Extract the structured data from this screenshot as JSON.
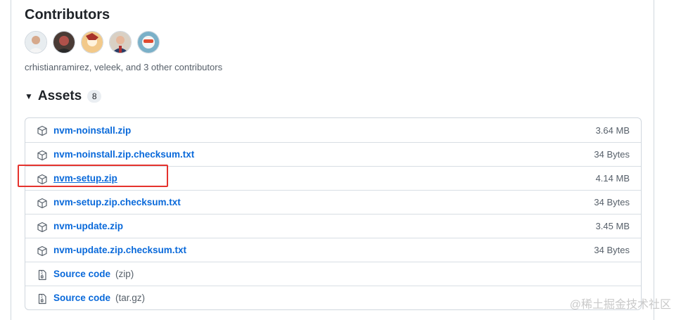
{
  "contributors": {
    "title": "Contributors",
    "summary": "crhistianramirez, veleek, and 3 other contributors",
    "avatars": [
      {
        "icon": "avatar-person-1",
        "bg": "#e8edf0",
        "fg": "#c9a58a"
      },
      {
        "icon": "avatar-person-2",
        "bg": "#4a3b35",
        "fg": "#b0514a"
      },
      {
        "icon": "avatar-person-3",
        "bg": "#f2c98a",
        "fg": "#a8322a"
      },
      {
        "icon": "avatar-person-4",
        "bg": "#d9d0c4",
        "fg": "#2b3d66"
      },
      {
        "icon": "avatar-person-5",
        "bg": "#7ab0c8",
        "fg": "#e04a2f"
      }
    ]
  },
  "assets": {
    "title": "Assets",
    "count": "8",
    "items": [
      {
        "name": "nvm-noinstall.zip",
        "ext": "",
        "size": "3.64 MB",
        "icon": "package-icon"
      },
      {
        "name": "nvm-noinstall.zip.checksum.txt",
        "ext": "",
        "size": "34 Bytes",
        "icon": "package-icon"
      },
      {
        "name": "nvm-setup.zip",
        "ext": "",
        "size": "4.14 MB",
        "icon": "package-icon"
      },
      {
        "name": "nvm-setup.zip.checksum.txt",
        "ext": "",
        "size": "34 Bytes",
        "icon": "package-icon"
      },
      {
        "name": "nvm-update.zip",
        "ext": "",
        "size": "3.45 MB",
        "icon": "package-icon"
      },
      {
        "name": "nvm-update.zip.checksum.txt",
        "ext": "",
        "size": "34 Bytes",
        "icon": "package-icon"
      },
      {
        "name": "Source code",
        "ext": "(zip)",
        "size": "",
        "icon": "file-zip-icon"
      },
      {
        "name": "Source code",
        "ext": "(tar.gz)",
        "size": "",
        "icon": "file-zip-icon"
      }
    ]
  },
  "watermark": "@稀土掘金技术社区",
  "colors": {
    "link": "#0969da",
    "highlight": "#e5322d"
  }
}
